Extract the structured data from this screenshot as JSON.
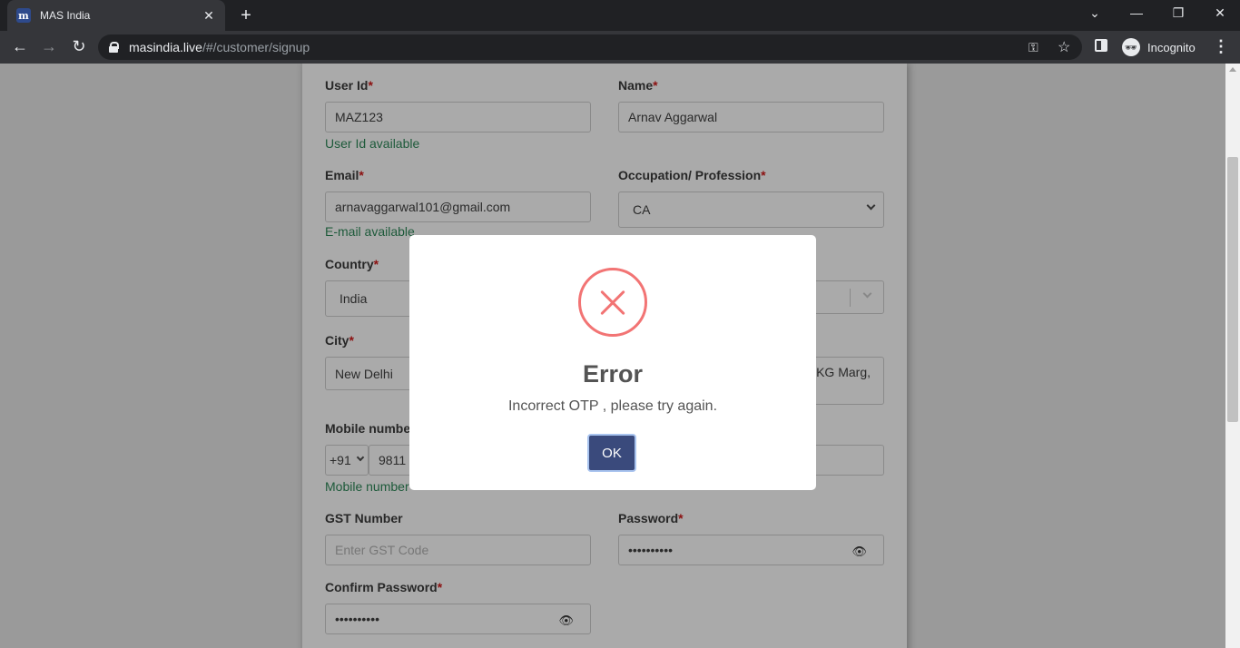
{
  "browser": {
    "tab_title": "MAS India",
    "tab_favicon": "m",
    "new_tab": "+",
    "close_tab": "✕",
    "url_host": "masindia.live",
    "url_path": "/#/customer/signup",
    "profile_label": "Incognito"
  },
  "form": {
    "user_id_label": "User Id",
    "user_id_value": "MAZ123",
    "user_id_hint": "User Id available",
    "name_label": "Name",
    "name_value": "Arnav Aggarwal",
    "email_label": "Email",
    "email_value": "arnavaggarwal101@gmail.com",
    "email_hint": "E-mail available",
    "occupation_label": "Occupation/ Profession",
    "occupation_value": "CA",
    "country_label": "Country",
    "country_value": "India",
    "city_label": "City",
    "city_value": "New Delhi",
    "address_partial": "KG Marg,",
    "mobile_label": "Mobile numbe",
    "mobile_code": "+91",
    "mobile_value": "9811",
    "mobile_hint": "Mobile number",
    "gst_label": "GST Number",
    "gst_placeholder": "Enter GST Code",
    "password_label": "Password",
    "password_value": "••••••••••",
    "confirm_label": "Confirm Password",
    "confirm_value": "••••••••••",
    "required_mark": "*"
  },
  "modal": {
    "title": "Error",
    "message": "Incorrect OTP , please try again.",
    "ok_label": "OK"
  },
  "colors": {
    "error_icon": "#f27474",
    "ok_button": "#3a4a7c"
  }
}
